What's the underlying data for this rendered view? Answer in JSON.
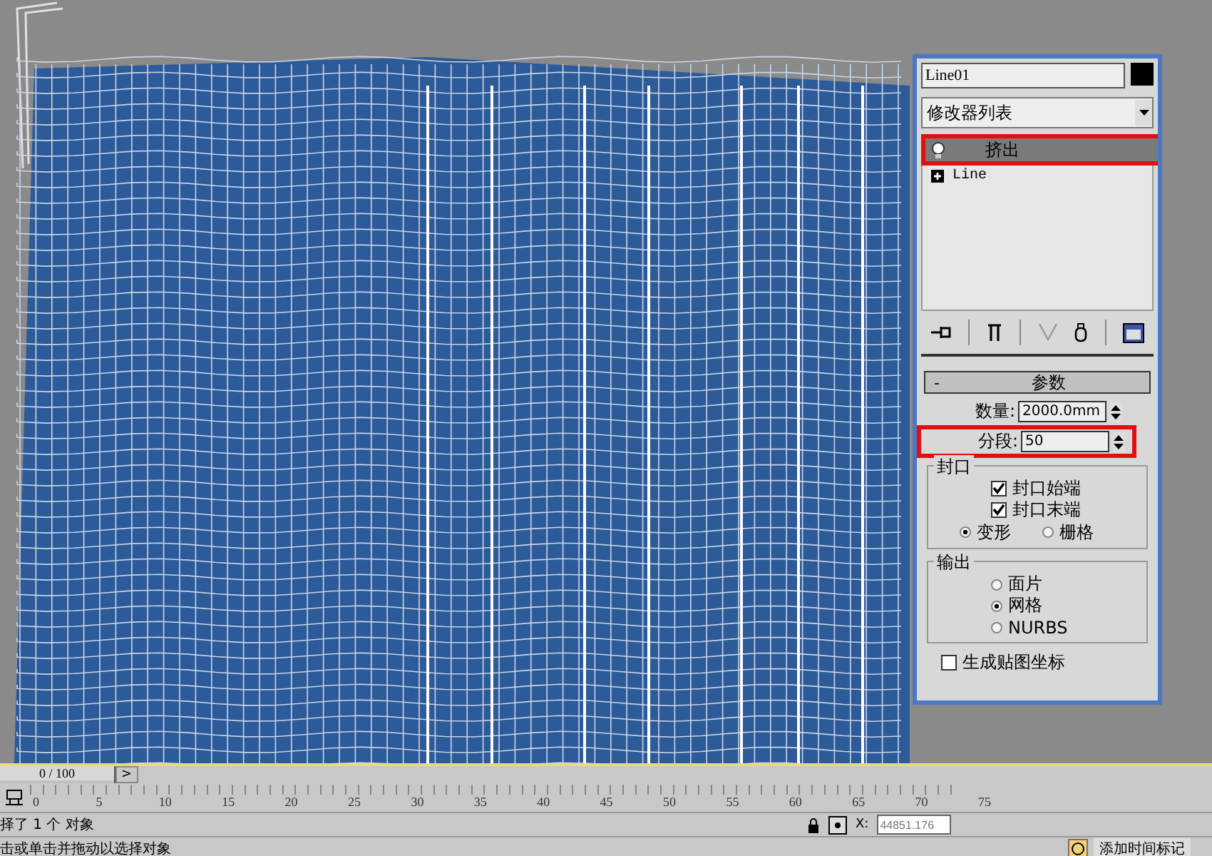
{
  "modifier_panel": {
    "object_name": "Line01",
    "modifier_list": "修改器列表",
    "stack": [
      {
        "label": "挤出",
        "kind": "modifier",
        "selected": true
      },
      {
        "label": "Line",
        "kind": "base",
        "selected": false
      }
    ]
  },
  "parameters": {
    "collapse": "-",
    "title": "参数",
    "amount": {
      "label": "数量:",
      "value": "2000.0mm"
    },
    "segments": {
      "label": "分段:",
      "value": "50"
    },
    "cap": {
      "title": "封口",
      "checks": [
        {
          "label": "封口始端",
          "checked": true
        },
        {
          "label": "封口末端",
          "checked": true
        }
      ],
      "options": [
        {
          "label": "变形",
          "selected": true
        },
        {
          "label": "栅格",
          "selected": false
        }
      ]
    },
    "output": {
      "title": "输出",
      "options": [
        {
          "label": "面片",
          "selected": false
        },
        {
          "label": "网格",
          "selected": true
        },
        {
          "label": "NURBS",
          "selected": false
        }
      ]
    },
    "generate_mapping": {
      "label": "生成贴图坐标",
      "checked": false
    }
  },
  "timeline": {
    "frame": "0 / 100",
    "next": ">",
    "level": 0,
    "ticks": [
      "0",
      "5",
      "10",
      "15",
      "20",
      "25",
      "30",
      "35",
      "40",
      "45",
      "50",
      "55",
      "60",
      "65",
      "70",
      "75"
    ]
  },
  "status_bar": {
    "selection": "择了 1 个 对象",
    "prompt": "击或单击并拖动以选择对象",
    "x_label": "X:",
    "x_value": "44851.176",
    "time_tag": "添加时间标记"
  }
}
